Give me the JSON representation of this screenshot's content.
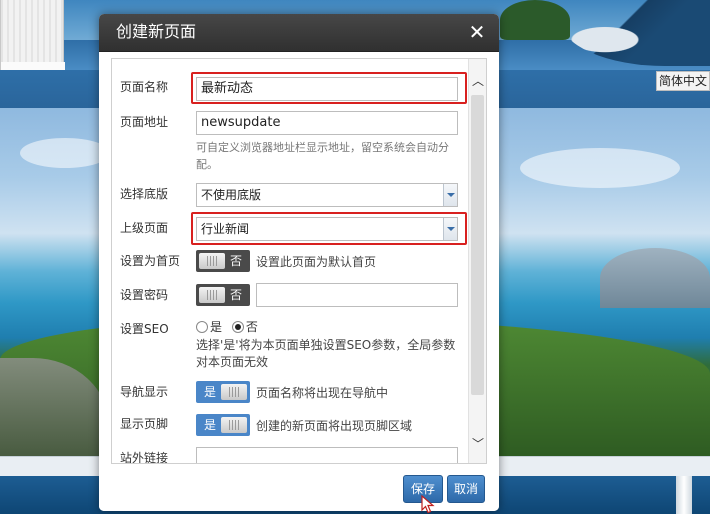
{
  "background": {
    "language_button": "简体中文"
  },
  "dialog": {
    "title": "创建新页面",
    "close_symbol": "✕",
    "fields": {
      "page_name": {
        "label": "页面名称",
        "value": "最新动态"
      },
      "page_address": {
        "label": "页面地址",
        "value": "newsupdate",
        "hint": "可自定义浏览器地址栏显示地址，留空系统会自动分配。"
      },
      "base_template": {
        "label": "选择底版",
        "selected": "不使用底版"
      },
      "parent_page": {
        "label": "上级页面",
        "selected": "行业新闻"
      },
      "set_homepage": {
        "label": "设置为首页",
        "toggle_text": "否",
        "description": "设置此页面为默认首页"
      },
      "set_password": {
        "label": "设置密码",
        "toggle_text": "否",
        "value": ""
      },
      "set_seo": {
        "label": "设置SEO",
        "options": [
          "是",
          "否"
        ],
        "selected": "否",
        "hint": "选择'是'将为本页面单独设置SEO参数，全局参数对本页面无效"
      },
      "nav_display": {
        "label": "导航显示",
        "toggle_text": "是",
        "description": "页面名称将出现在导航中"
      },
      "footer_display": {
        "label": "显示页脚",
        "toggle_text": "是",
        "description": "创建的新页面将出现页脚区域"
      },
      "external_link": {
        "label": "站外链接",
        "value": ""
      }
    },
    "buttons": {
      "save": "保存",
      "cancel": "取消"
    }
  },
  "colors": {
    "highlight_red": "#d8201f",
    "toggle_on_blue": "#4a86c8",
    "toggle_off_gray": "#4a4a4a",
    "button_blue": "#3a7bbd",
    "header_dark": "#3a3a3a"
  }
}
